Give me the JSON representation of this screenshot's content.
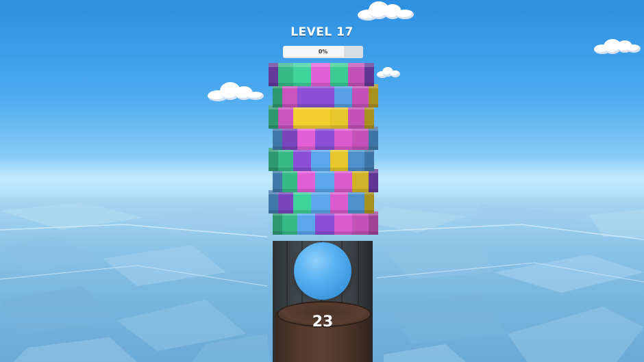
{
  "hud": {
    "level_label": "LEVEL 17",
    "progress_label": "0%",
    "progress_fraction": 0.0
  },
  "cannon": {
    "balls_remaining": "23",
    "ball_color": "#4aa8ee"
  },
  "palette": {
    "purple": "#8a4fd6",
    "teal": "#3ed39a",
    "magenta": "#e35fd6",
    "blue": "#5aa7ec",
    "yellow": "#f2cf2e",
    "sky": "#3aa0e6"
  },
  "tower": {
    "rows": [
      [
        "purple",
        "teal",
        "teal",
        "magenta",
        "teal",
        "magenta",
        "purple"
      ],
      [
        "teal",
        "magenta",
        "purple",
        "purple",
        "blue",
        "magenta",
        "yellow"
      ],
      [
        "teal",
        "magenta",
        "yellow",
        "yellow",
        "yellow",
        "magenta",
        "yellow"
      ],
      [
        "blue",
        "purple",
        "magenta",
        "purple",
        "magenta",
        "magenta",
        "blue"
      ],
      [
        "teal",
        "teal",
        "purple",
        "blue",
        "yellow",
        "blue",
        "blue"
      ],
      [
        "blue",
        "teal",
        "magenta",
        "blue",
        "magenta",
        "yellow",
        "purple"
      ],
      [
        "blue",
        "purple",
        "teal",
        "blue",
        "magenta",
        "blue",
        "yellow"
      ],
      [
        "teal",
        "teal",
        "blue",
        "purple",
        "magenta",
        "magenta",
        "magenta"
      ]
    ]
  }
}
